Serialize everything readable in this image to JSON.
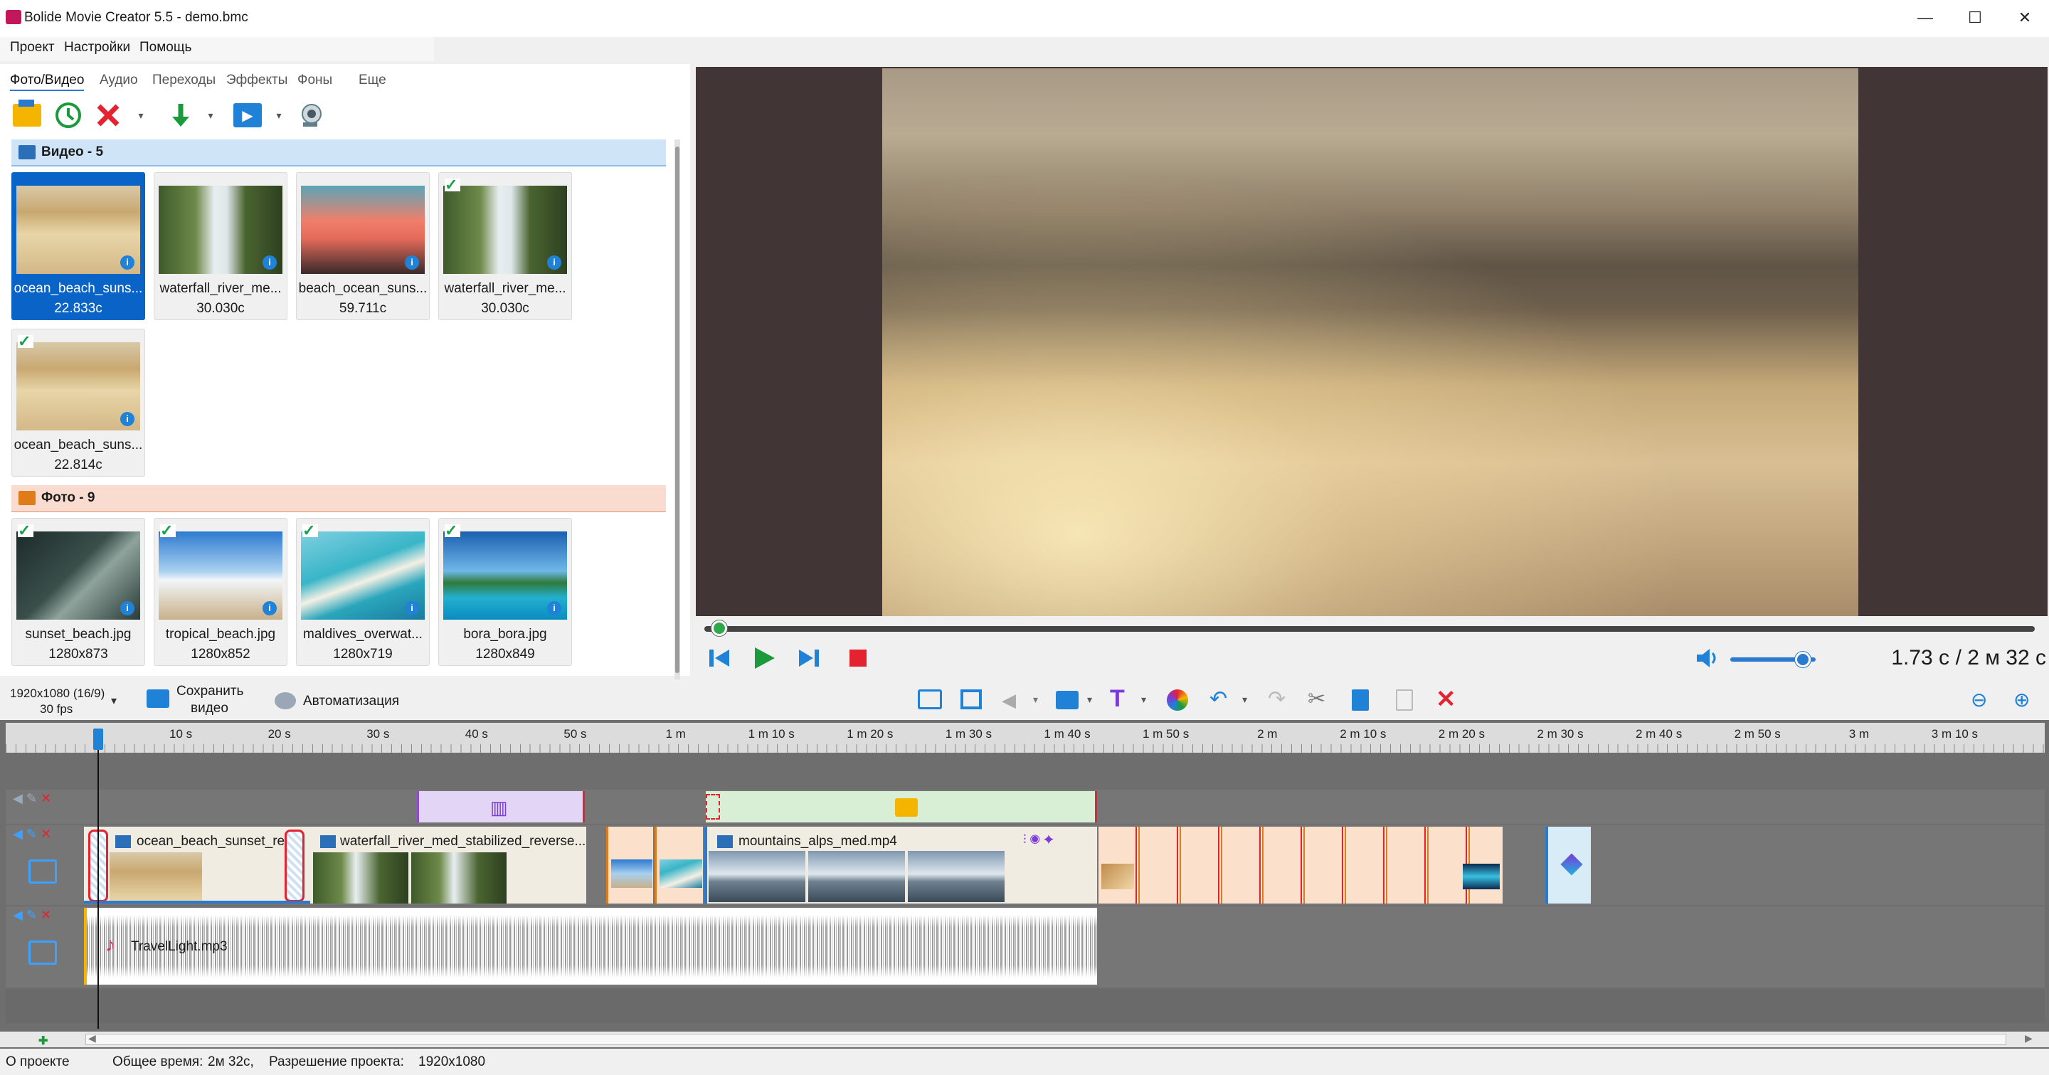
{
  "window": {
    "title": "Bolide Movie Creator 5.5 - demo.bmc",
    "minimize": "—",
    "maximize": "☐",
    "close": "✕"
  },
  "menu": [
    "Проект",
    "Настройки",
    "Помощь"
  ],
  "tabs": [
    "Фото/Видео",
    "Аудио",
    "Переходы",
    "Эффекты",
    "Фоны",
    "Еще"
  ],
  "groups": {
    "video": "Видео - 5",
    "photo": "Фото - 9"
  },
  "video_tiles": [
    {
      "name": "ocean_beach_suns...",
      "meta": "22.833с"
    },
    {
      "name": "waterfall_river_me...",
      "meta": "30.030с"
    },
    {
      "name": "beach_ocean_suns...",
      "meta": "59.711с"
    },
    {
      "name": "waterfall_river_me...",
      "meta": "30.030с"
    },
    {
      "name": "ocean_beach_suns...",
      "meta": "22.814с"
    }
  ],
  "photo_tiles": [
    {
      "name": "sunset_beach.jpg",
      "meta": "1280x873"
    },
    {
      "name": "tropical_beach.jpg",
      "meta": "1280x852"
    },
    {
      "name": "maldives_overwat...",
      "meta": "1280x719"
    },
    {
      "name": "bora_bora.jpg",
      "meta": "1280x849"
    }
  ],
  "player": {
    "current_time": "1.73 с",
    "total_time": "/ 2 м 32 с",
    "progress": 0.011,
    "volume": 0.85
  },
  "strip": {
    "resolution": "1920x1080 (16/9)",
    "fps": "30 fps",
    "save_line1": "Сохранить",
    "save_line2": "видео",
    "automation": "Автоматизация"
  },
  "ruler": [
    "10 s",
    "20 s",
    "30 s",
    "40 s",
    "50 s",
    "1 m",
    "1 m 10 s",
    "1 m 20 s",
    "1 m 30 s",
    "1 m 40 s",
    "1 m 50 s",
    "2 m",
    "2 m 10 s",
    "2 m 20 s",
    "2 m 30 s",
    "2 m 40 s",
    "2 m 50 s",
    "3 m",
    "3 m 10 s"
  ],
  "clips": {
    "clip1": "ocean_beach_sunset_re",
    "clip2": "waterfall_river_med_stabilized_reverse...",
    "clip3": "mountains_alps_med.mp4",
    "audio": "TravelLight.mp3"
  },
  "status": {
    "about": "О проекте",
    "total_label": "Общее время:",
    "total_value": "2м 32с,",
    "res_label": "Разрешение проекта:",
    "res_value": "1920x1080"
  }
}
